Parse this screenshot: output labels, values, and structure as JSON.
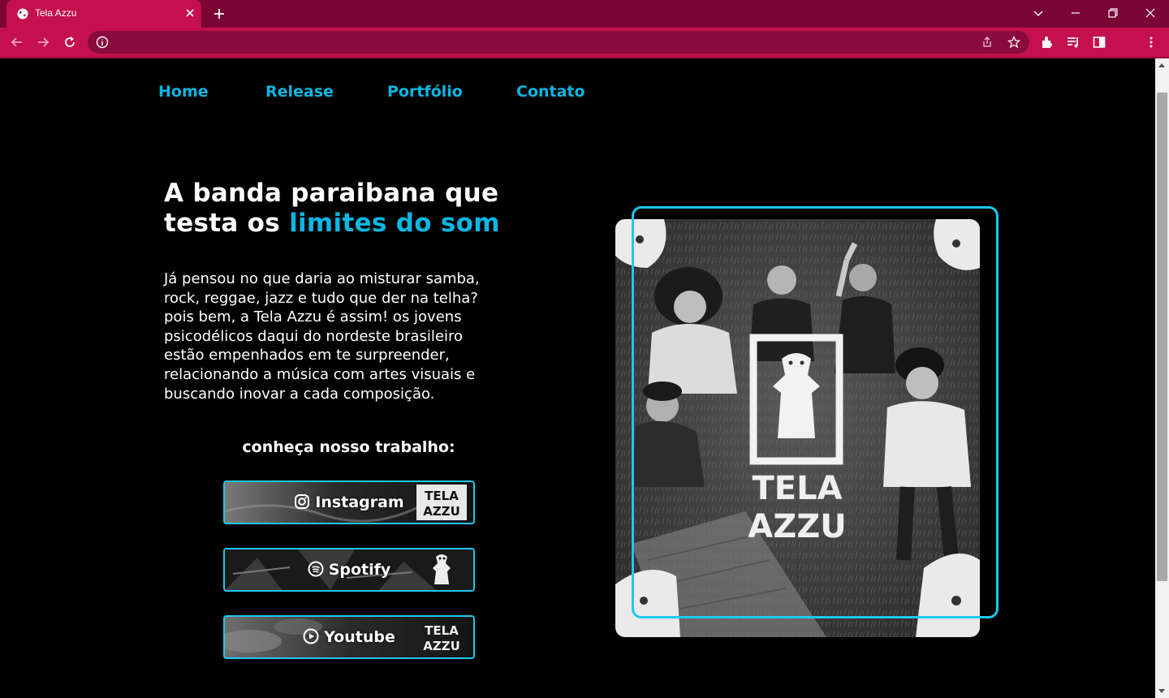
{
  "browser": {
    "tab_title": "Tela Azzu",
    "colors": {
      "tabbar": "#7a0535",
      "active_tab": "#c4104f"
    }
  },
  "nav": {
    "items": [
      "Home",
      "Release",
      "Portfólio",
      "Contato"
    ]
  },
  "hero": {
    "title_line1": "A banda paraibana que",
    "title_line2_plain": "testa os ",
    "title_line2_accent": "limites do som",
    "paragraph_lines": [
      "Já pensou no que daria ao misturar samba,",
      "rock, reggae, jazz e tudo que der na telha?",
      "pois bem, a Tela Azzu é assim! os jovens",
      "psicodélicos daqui do nordeste brasileiro",
      "estão empenhados em te surpreender,",
      "relacionando a música com artes visuais e",
      "buscando inovar a cada composição."
    ],
    "cta": "conheça nosso trabalho:"
  },
  "social": [
    {
      "label": "Instagram",
      "icon": "instagram-icon"
    },
    {
      "label": "Spotify",
      "icon": "spotify-icon"
    },
    {
      "label": "Youtube",
      "icon": "youtube-icon"
    }
  ],
  "photo": {
    "logo_text_line1": "TELA",
    "logo_text_line2": "AZZU"
  },
  "colors": {
    "accent": "#0bb6e2",
    "border": "#1ec8ef",
    "background": "#000000"
  }
}
